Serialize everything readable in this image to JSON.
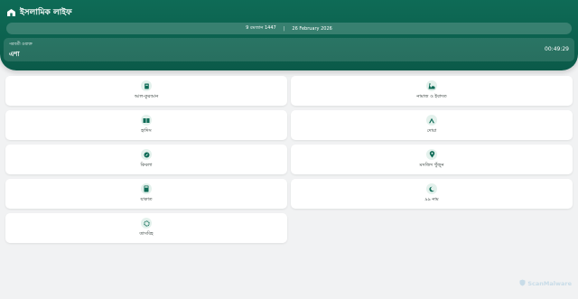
{
  "app": {
    "title": "ইসলামিক লাইফ",
    "icon": "mosque-icon"
  },
  "date": {
    "hijri": "9 রমজান 1447",
    "separator": "|",
    "gregorian": "26 February 2026"
  },
  "prayer": {
    "label": "পরবর্তী ওয়াক্ত",
    "name": "এশা",
    "countdown": "00:49:29"
  },
  "menu": [
    {
      "label": "আল-কুরআন",
      "icon": "quran-icon"
    },
    {
      "label": "নামাজ ও ইবাদত",
      "icon": "prayer-icon"
    },
    {
      "label": "হাদিস",
      "icon": "book-icon"
    },
    {
      "label": "দোয়া",
      "icon": "dua-icon"
    },
    {
      "label": "কিবলা",
      "icon": "compass-icon"
    },
    {
      "label": "মসজিদ খুঁজুন",
      "icon": "location-pin-icon"
    },
    {
      "label": "যাকাত",
      "icon": "calculator-icon"
    },
    {
      "label": "৯৯ নাম",
      "icon": "crescent-icon"
    },
    {
      "label": "তাসবিহ",
      "icon": "tasbih-icon"
    }
  ],
  "watermark": {
    "text": "ScanMalware",
    "icon": "shield-icon"
  },
  "colors": {
    "primary": "#0e6b56",
    "icon_bg": "#e3f1ec",
    "background": "#f1f2f3"
  }
}
